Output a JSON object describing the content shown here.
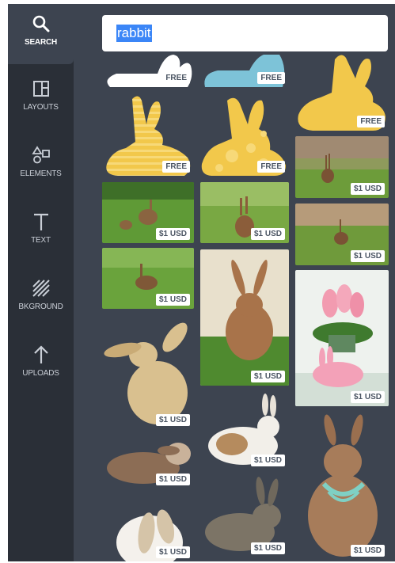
{
  "sidebar": {
    "items": [
      {
        "label": "SEARCH",
        "icon": "search-icon"
      },
      {
        "label": "LAYOUTS",
        "icon": "layouts-icon"
      },
      {
        "label": "ELEMENTS",
        "icon": "elements-icon"
      },
      {
        "label": "TEXT",
        "icon": "text-icon"
      },
      {
        "label": "BKGROUND",
        "icon": "background-icon"
      },
      {
        "label": "UPLOADS",
        "icon": "upload-icon"
      }
    ]
  },
  "search": {
    "value": "rabbit"
  },
  "results": [
    {
      "name": "white-bunny-shape",
      "price": "FREE"
    },
    {
      "name": "blue-bunny-shape",
      "price": "FREE"
    },
    {
      "name": "yellow-bunny-shape",
      "price": "FREE"
    },
    {
      "name": "striped-yellow-bunny",
      "price": "FREE"
    },
    {
      "name": "dotted-yellow-bunny",
      "price": "FREE"
    },
    {
      "name": "hare-in-field-photo",
      "price": "$1 USD"
    },
    {
      "name": "rabbits-in-grass-photo",
      "price": "$1 USD"
    },
    {
      "name": "rabbit-sitting-photo",
      "price": "$1 USD"
    },
    {
      "name": "hare-in-meadow-photo",
      "price": "$1 USD"
    },
    {
      "name": "rabbit-in-grass-photo",
      "price": "$1 USD"
    },
    {
      "name": "brown-rabbit-upright-photo",
      "price": "$1 USD"
    },
    {
      "name": "bunny-cookie-tulips-photo",
      "price": "$1 USD"
    },
    {
      "name": "lop-rabbit-cutout",
      "price": "$1 USD"
    },
    {
      "name": "white-brown-rabbit-cutout",
      "price": "$1 USD"
    },
    {
      "name": "lying-rabbit-cutout",
      "price": "$1 USD"
    },
    {
      "name": "rabbit-with-necklace-cutout",
      "price": "$1 USD"
    },
    {
      "name": "white-lop-rabbit-cutout",
      "price": "$1 USD"
    },
    {
      "name": "grey-rabbit-cutout",
      "price": "$1 USD"
    }
  ]
}
